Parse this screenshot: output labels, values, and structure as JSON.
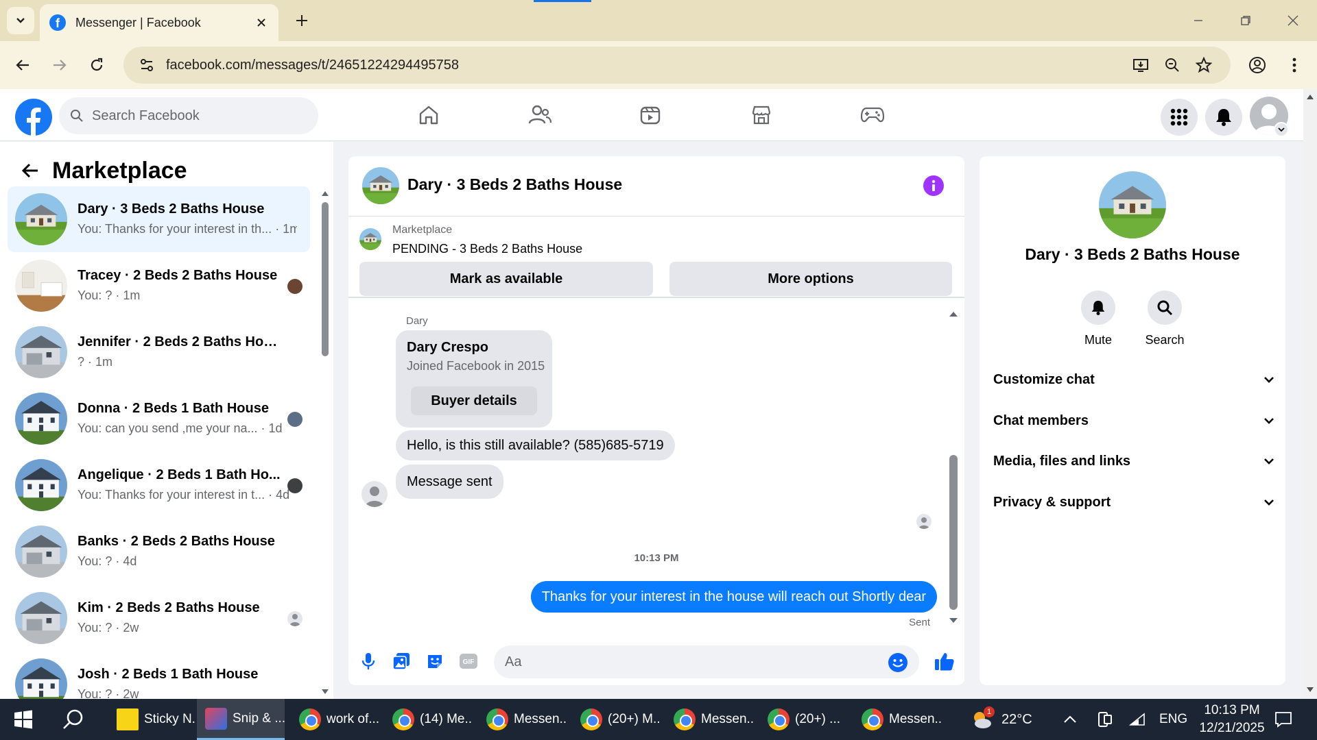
{
  "browser": {
    "tab_title": "Messenger | Facebook",
    "url": "facebook.com/messages/t/24651224294495758"
  },
  "fb": {
    "search_placeholder": "Search Facebook"
  },
  "left": {
    "title": "Marketplace",
    "chats": [
      {
        "name": "Dary · 3 Beds 2 Baths House",
        "preview": "You: Thanks for your interest in th...",
        "time": "· 1m",
        "active": true
      },
      {
        "name": "Tracey · 2 Beds 2 Baths House",
        "preview": "You: ?",
        "time": "· 1m"
      },
      {
        "name": "Jennifer · 2 Beds 2 Baths House",
        "preview": "?",
        "time": "· 1m"
      },
      {
        "name": "Donna · 2 Beds 1 Bath House",
        "preview": "You: can you send ,me your na...",
        "time": "· 1d"
      },
      {
        "name": "Angelique · 2 Beds 1 Bath Ho...",
        "preview": "You: Thanks for your interest in t...",
        "time": "· 4d"
      },
      {
        "name": "Banks · 2 Beds 2 Baths House",
        "preview": "You: ?",
        "time": "· 4d"
      },
      {
        "name": "Kim · 2 Beds 2 Baths House",
        "preview": "You: ?",
        "time": "· 2w"
      },
      {
        "name": "Josh · 2 Beds 1 Bath House",
        "preview": "You: ?",
        "time": "· 2w"
      }
    ]
  },
  "convo": {
    "title": "Dary · 3 Beds 2 Baths House",
    "marketplace_label": "Marketplace",
    "listing_status": "PENDING - 3 Beds 2 Baths House",
    "mark_available": "Mark as available",
    "more_options": "More options",
    "sender_label": "Dary",
    "card_name": "Dary Crespo",
    "card_joined": "Joined Facebook in 2015",
    "buyer_details": "Buyer details",
    "msg1": "Hello, is this still available? (585)685-5719",
    "msg2": "Message sent",
    "time_sep": "10:13 PM",
    "msg_out": "Thanks for your interest in the house will reach out Shortly dear",
    "sent": "Sent",
    "composer_placeholder": "Aa"
  },
  "right": {
    "name": "Dary · 3 Beds 2 Baths House",
    "mute": "Mute",
    "search": "Search",
    "sections": [
      "Customize chat",
      "Chat members",
      "Media, files and links",
      "Privacy & support"
    ]
  },
  "taskbar": {
    "apps": [
      "Sticky N...",
      "Snip & ...",
      "work of...",
      "(14) Me...",
      "Messen...",
      "(20+) M...",
      "Messen...",
      "(20+) ...",
      "Messen..."
    ],
    "temperature": "22°C",
    "weather_badge": "1",
    "language": "ENG",
    "time": "10:13 PM",
    "date": "12/21/2025"
  },
  "colors": {
    "fb_blue": "#1877f2",
    "message_blue": "#0a7cff",
    "info_purple": "#a033ff",
    "active_chat_bg": "#ebf5ff"
  }
}
